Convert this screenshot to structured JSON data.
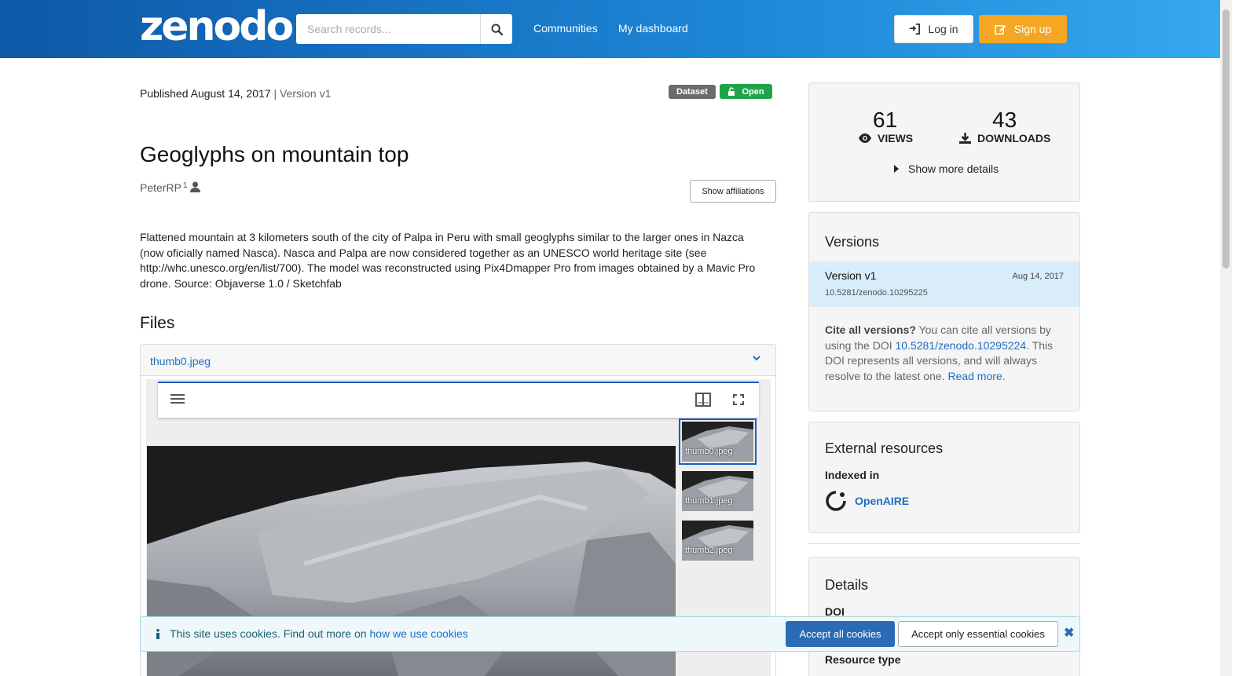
{
  "header": {
    "logo_text": "zenodo",
    "search_placeholder": "Search records...",
    "nav": [
      "Communities",
      "My dashboard"
    ],
    "login_label": "Log in",
    "signup_label": "Sign up",
    "colors": {
      "bar_start": "#0e58a8",
      "bar_end": "#36a9ef",
      "signup": "#f5a623"
    }
  },
  "record": {
    "published": "Published August 14, 2017",
    "version": "| Version v1",
    "badge_type": "Dataset",
    "badge_access": "Open",
    "title": "Geoglyphs on mountain top",
    "creator": "PeterRP",
    "creator_affil_index": "1",
    "show_affiliations_label": "Show affiliations",
    "description": "Flattened mountain at 3 kilometers south of the city of Palpa in Peru with small geoglyphs similar to the larger ones in Nazca (now oficially named Nasca). Nasca and Palpa are now considered together as an UNESCO world heritage site (see http://whc.unesco.org/en/list/700). The model was reconstructed using Pix4Dmapper Pro from images obtained by a Mavic Pro drone. Source: Objaverse 1.0 / Sketchfab",
    "files_heading": "Files",
    "file_name": "thumb0.jpeg",
    "thumbnails": [
      "thumb0.jpeg",
      "thumb1.jpeg",
      "thumb2.jpeg"
    ]
  },
  "stats": {
    "views": "61",
    "views_label": "VIEWS",
    "downloads": "43",
    "downloads_label": "DOWNLOADS",
    "more_details_label": "Show more details"
  },
  "versions": {
    "heading": "Versions",
    "items": [
      {
        "name": "Version v1",
        "date": "Aug 14, 2017",
        "doi": "10.5281/zenodo.10295225"
      }
    ],
    "cite_bold": "Cite all versions?",
    "cite_text_1": " You can cite all versions by using the DOI ",
    "cite_doi": "10.5281/zenodo.10295224",
    "cite_text_2": ". This DOI represents all versions, and will always resolve to the latest one. ",
    "read_more": "Read more."
  },
  "external": {
    "heading": "External resources",
    "indexed_in": "Indexed in",
    "openaire": "OpenAIRE"
  },
  "details": {
    "heading": "Details",
    "doi_label": "DOI",
    "resource_type_label": "Resource type"
  },
  "cookie": {
    "text": "This site uses cookies. Find out more on ",
    "link": "how we use cookies",
    "accept_all": "Accept all cookies",
    "accept_essential": "Accept only essential cookies"
  }
}
